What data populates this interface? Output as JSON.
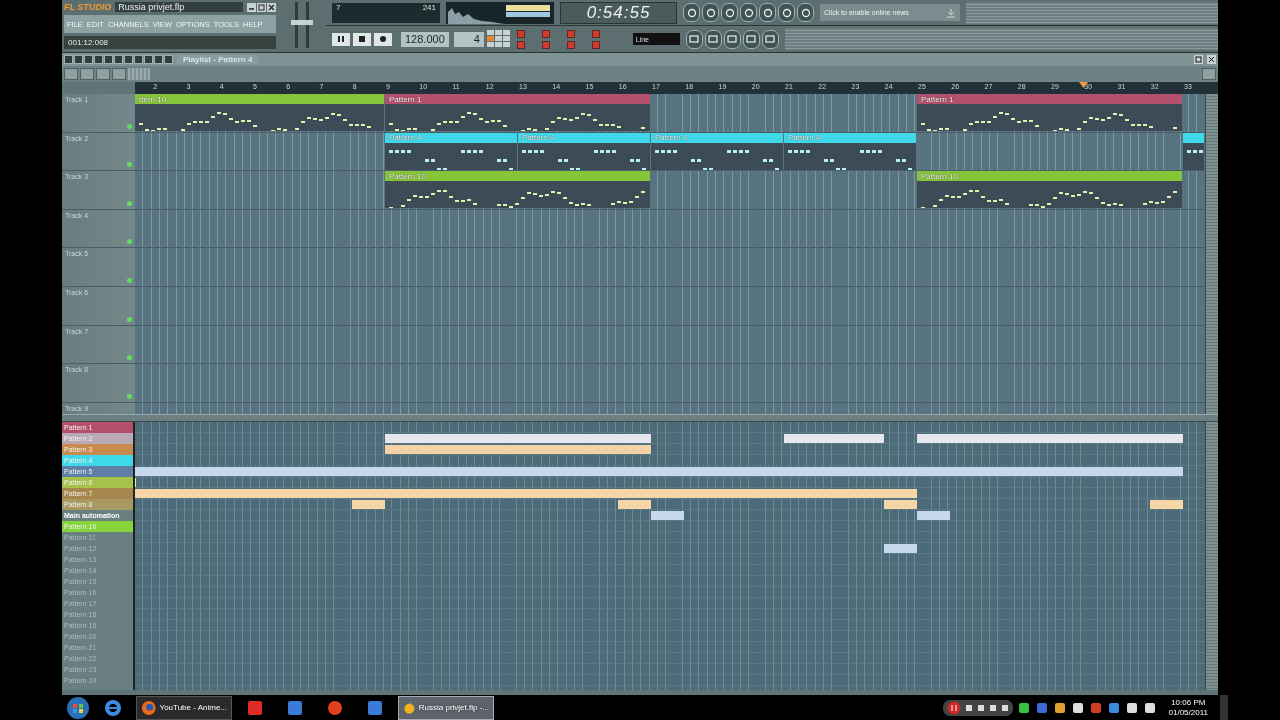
{
  "app": {
    "master_volume": {
      "level": 0.55
    },
    "master_pitch": {
      "level": 0.55
    },
    "logo": "FL STUDIO",
    "file_title": "Russia privjet.flp",
    "menu": [
      "FILE",
      "EDIT",
      "CHANNELS",
      "VIEW",
      "OPTIONS",
      "TOOLS",
      "HELP"
    ],
    "hint": "001:12:008",
    "cpu": "7",
    "poly": "241",
    "time": "0:54:55",
    "tempo": "128.000",
    "pattern_number": "4",
    "snap": "Line",
    "news": "Click to enable online news"
  },
  "playlist": {
    "title": "Playlist - Pattern 4",
    "ruler": [
      "2",
      "3",
      "4",
      "5",
      "6",
      "7",
      "8",
      "9",
      "10",
      "11",
      "12",
      "13",
      "14",
      "15",
      "16",
      "17",
      "18",
      "19",
      "20",
      "21",
      "22",
      "23",
      "24",
      "25",
      "26",
      "27",
      "28",
      "29",
      "30",
      "31",
      "32",
      "33"
    ],
    "tracks": [
      {
        "name": "Track 1",
        "clips": [
          {
            "label": "ttern 10",
            "color": "#86c43a"
          },
          {
            "label": "Pattern 1",
            "color": "#b4506e"
          },
          {
            "label": "Pattern 1",
            "color": "#b4506e"
          }
        ]
      },
      {
        "name": "Track 2",
        "clips": [
          {
            "label": "Pattern 4",
            "color": "#3fd8e8"
          },
          {
            "label": "Pattern 4",
            "color": "#3fd8e8"
          },
          {
            "label": "Pattern 4",
            "color": "#3fd8e8"
          },
          {
            "label": "Pattern 4",
            "color": "#3fd8e8"
          },
          {
            "color": "#3fd8e8"
          }
        ]
      },
      {
        "name": "Track 3",
        "clips": [
          {
            "label": "Pattern 10",
            "color": "#86c43a"
          },
          {
            "label": "Pattern 10",
            "color": "#86c43a"
          }
        ]
      },
      {
        "name": "Track 4"
      },
      {
        "name": "Track 5"
      },
      {
        "name": "Track 6"
      },
      {
        "name": "Track 7"
      },
      {
        "name": "Track 8"
      },
      {
        "name": "Track 9"
      }
    ]
  },
  "patterns": [
    {
      "label": "Pattern 1",
      "color": "#b4506e"
    },
    {
      "label": "Pattern 2",
      "color": "#b9a8b6"
    },
    {
      "label": "Pattern 3",
      "color": "#c98a4e"
    },
    {
      "label": "Pattern 4",
      "color": "#3fd8e8"
    },
    {
      "label": "Pattern 5",
      "color": "#5f7fa6"
    },
    {
      "label": "Pattern 6",
      "color": "#a6c24a"
    },
    {
      "label": "Pattern 7",
      "color": "#a7864e"
    },
    {
      "label": "Pattern 8",
      "color": "#a99a62"
    },
    {
      "label": "Main automation",
      "kind": "automation"
    },
    {
      "label": "Pattern 10",
      "color": "#86d43a"
    },
    {
      "label": "Pattern 11"
    },
    {
      "label": "Pattern 12"
    },
    {
      "label": "Pattern 13"
    },
    {
      "label": "Pattern 14"
    },
    {
      "label": "Pattern 15"
    },
    {
      "label": "Pattern 16"
    },
    {
      "label": "Pattern 17"
    },
    {
      "label": "Pattern 18"
    },
    {
      "label": "Pattern 19"
    },
    {
      "label": "Pattern 20"
    },
    {
      "label": "Pattern 21"
    },
    {
      "label": "Pattern 22"
    },
    {
      "label": "Pattern 23"
    },
    {
      "label": "Pattern 24"
    }
  ],
  "taskbar": {
    "tasks": [
      {
        "label": "YouTube - Anime...",
        "selected": false
      },
      {
        "label": "Russia privjet.flp -...",
        "selected": true
      }
    ],
    "time": "10:06 PM",
    "date": "01/05/2011"
  }
}
